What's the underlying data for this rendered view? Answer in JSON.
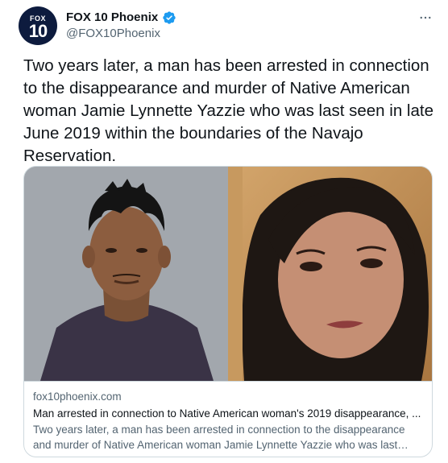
{
  "account": {
    "avatar_top": "FOX",
    "avatar_number": "10",
    "display_name": "FOX 10 Phoenix",
    "handle": "@FOX10Phoenix",
    "verified": true
  },
  "tweet": {
    "text": "Two years later, a man has been arrested in connection to the disappearance and murder of Native American woman Jamie Lynnette Yazzie who was last seen in late June 2019 within the boundaries of the Navajo Reservation."
  },
  "card": {
    "domain": "fox10phoenix.com",
    "title": "Man arrested in connection to Native American woman's 2019 disappearance, ...",
    "description": "Two years later, a man has been arrested in connection to the disappearance and murder of Native American woman Jamie Lynnette Yazzie who was last see..."
  },
  "icons": {
    "verified": "verified-badge-icon",
    "more": "more-options-icon"
  },
  "colors": {
    "brand_navy": "#0d1b3e",
    "verified_blue": "#1d9bf0",
    "text_primary": "#0f1419",
    "text_secondary": "#536471",
    "border": "#cfd9de"
  }
}
